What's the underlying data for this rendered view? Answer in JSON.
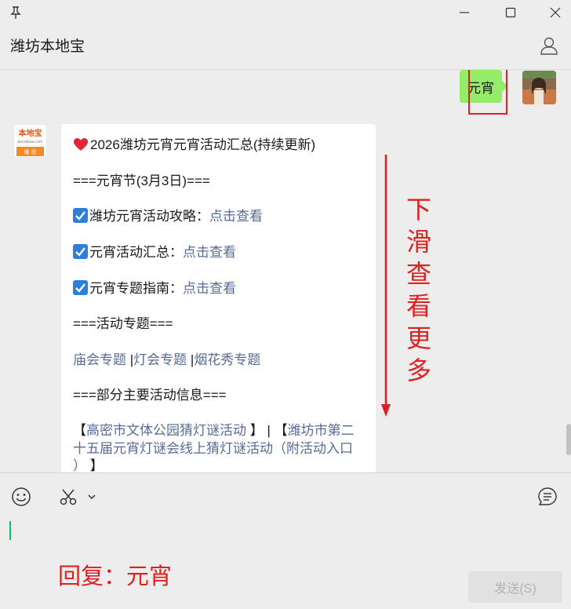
{
  "window": {
    "pin_icon": "pin-icon",
    "minimize_icon": "minimize-icon",
    "maximize_icon": "maximize-icon",
    "close_icon": "close-icon"
  },
  "header": {
    "title": "潍坊本地宝",
    "profile_icon": "profile-icon"
  },
  "conversation": {
    "my_message": "元宵",
    "bot_avatar_brand": "本地宝",
    "bot_avatar_domain": "bendibao.com",
    "bot_avatar_city": "潍 坊",
    "card": {
      "headline": "2026潍坊元宵元宵活动汇总(持续更新)",
      "section1": "===元宵节(3月3日)===",
      "items": [
        {
          "label": "潍坊元宵活动攻略：",
          "link": "点击查看"
        },
        {
          "label": "元宵活动汇总：",
          "link": "点击查看"
        },
        {
          "label": "元宵专题指南：",
          "link": "点击查看"
        }
      ],
      "section2": "===活动专题===",
      "topics": [
        "庙会专题",
        "灯会专题",
        "烟花秀专题"
      ],
      "section3": "===部分主要活动信息===",
      "activity_line1": "高密市文体公园猜灯谜活动",
      "activity_line2a": "潍坊市第二",
      "activity_line2b": "十五届元宵灯谜会线上猜灯谜活动（附活动入口",
      "activity_line3": "）"
    }
  },
  "annotations": {
    "scroll_hint": [
      "下",
      "滑",
      "查",
      "看",
      "更",
      "多"
    ],
    "reply_hint": "回复：元宵"
  },
  "input": {
    "emoji_icon": "emoji-icon",
    "scissors_icon": "scissors-icon",
    "chevron_icon": "chevron-down-icon",
    "history_icon": "chat-history-icon",
    "send_label": "发送(S)"
  },
  "colors": {
    "bubble_green": "#95ec69",
    "link_blue": "#576b95",
    "annotation_red": "#e02020",
    "background": "#ededed"
  }
}
